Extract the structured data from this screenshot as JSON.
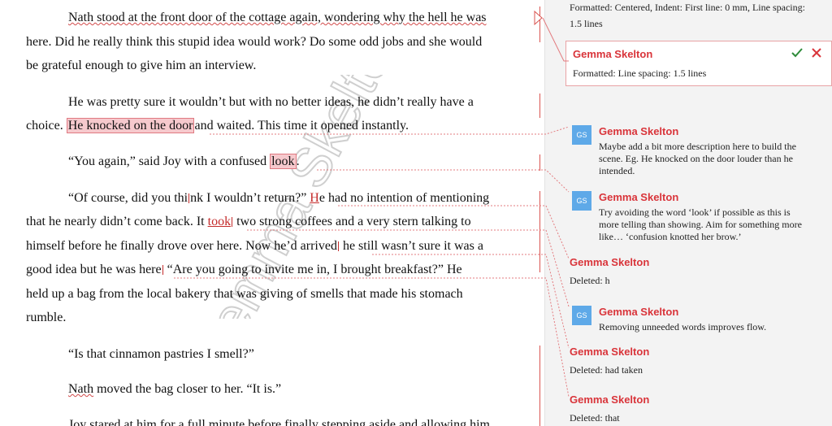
{
  "document": {
    "watermark": "Gemma Skelton",
    "lines": [
      "Nath stood at the front door of the cottage again, wondering why the hell he was",
      "here. Did he really think this stupid idea would work? Do some odd jobs and she would",
      "be grateful enough to give him an interview.",
      "He was pretty sure it wouldn’t but with no better ideas, he didn’t really have a",
      "choice. ",
      "He knocked on the door",
      "and waited. This time it opened instantly.",
      "“You again,”  said Joy with a confused ",
      "look",
      ".",
      "“Of course, did you thi",
      "nk I wouldn’t return?”  ",
      "H",
      "e had no intention of mentioning",
      "that he nearly didn’t come back. It ",
      "took",
      " two strong coffees and a very stern talking to",
      "himself before he finally drove over here. Now he’d arrived",
      " he still wasn’t sure it was a",
      "good idea but he was here",
      "  “Are you going to invite me in, I brought breakfast?”  He",
      "held up a bag from the local bakery that was giving of smells that made his stomach",
      "rumble.",
      "“Is that cinnamon pastries I smell?”",
      "Nath",
      " moved the bag closer to her.  “It is.”",
      "Joy stared at him for a full minute before finally stepping aside and allowing him"
    ]
  },
  "pane": {
    "top_format": "Formatted:  Centered, Indent: First line: 0 mm, Line spacing:",
    "top_format_2": "1.5 lines",
    "card1": {
      "author": "Gemma Skelton",
      "text": "Formatted:  Line spacing: 1.5 lines",
      "accept_icon": "check-icon",
      "reject_icon": "x-icon"
    },
    "comments": [
      {
        "initials": "GS",
        "author": "Gemma Skelton",
        "l1": "Maybe add a bit more description here to build the",
        "l2": "scene. Eg. He knocked on the door louder than he",
        "l3": "intended."
      },
      {
        "initials": "GS",
        "author": "Gemma Skelton",
        "l1": "Try avoiding the word ‘look’ if possible as this is",
        "l2": "more telling than showing. Aim for something more",
        "l3": "like… ‘confusion knotted her brow.’"
      },
      {
        "initials": "GS",
        "author": "Gemma Skelton",
        "l1": "Removing unneeded words improves flow."
      }
    ],
    "revisions": [
      {
        "author": "Gemma Skelton",
        "text": "Deleted:  h"
      },
      {
        "author": "Gemma Skelton",
        "text": "Deleted:  had taken"
      },
      {
        "author": "Gemma Skelton",
        "text": "Deleted:  that"
      }
    ]
  },
  "colors": {
    "accent": "#d9343a",
    "avatar": "#5ea9e8",
    "highlight": "#f6c9cd"
  }
}
